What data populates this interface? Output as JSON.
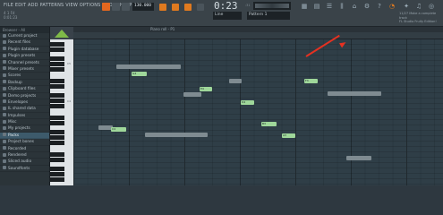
{
  "toolbar": {
    "menu": "FILE EDIT ADD PATTERNS VIEW OPTIONS TOOLS HELP",
    "song_info_line1": "4 1 Fd",
    "song_info_line2": "0:01:23",
    "tempo": "130.000",
    "time": "0:23",
    "time_sub": ":31",
    "pattern": "Pattern 1",
    "line": "Line",
    "news_line1": "11/27 Make a complete track",
    "news_line2": "FL Studio Fruity Edition!"
  },
  "browser": {
    "header": "Browser - All",
    "items": [
      {
        "label": "Current project",
        "active": false
      },
      {
        "label": "Recent files",
        "active": false
      },
      {
        "label": "Plugin database",
        "active": false
      },
      {
        "label": "Plugin presets",
        "active": false
      },
      {
        "label": "Channel presets",
        "active": false
      },
      {
        "label": "Mixer presets",
        "active": false
      },
      {
        "label": "Scores",
        "active": false
      },
      {
        "label": "Backup",
        "active": false
      },
      {
        "label": "Clipboard files",
        "active": false
      },
      {
        "label": "Demo projects",
        "active": false
      },
      {
        "label": "Envelopes",
        "active": false
      },
      {
        "label": "IL shared data",
        "active": false
      },
      {
        "label": "Impulses",
        "active": false
      },
      {
        "label": "Misc",
        "active": false
      },
      {
        "label": "My projects",
        "active": false
      },
      {
        "label": "Packs",
        "active": true
      },
      {
        "label": "Project bones",
        "active": false
      },
      {
        "label": "Recorded",
        "active": false
      },
      {
        "label": "Rendered",
        "active": false
      },
      {
        "label": "Sliced audio",
        "active": false
      },
      {
        "label": "Soundfonts",
        "active": false
      }
    ]
  },
  "piano_roll": {
    "title": "Piano roll - P1",
    "key_labels": [
      "C5",
      "C4"
    ],
    "notes": [
      {
        "label": "",
        "color": "gray"
      },
      {
        "label": "",
        "color": "gray"
      },
      {
        "label": "",
        "color": "gray"
      },
      {
        "label": "G4",
        "color": "green"
      },
      {
        "label": "E4",
        "color": "green"
      },
      {
        "label": "D4",
        "color": "green"
      },
      {
        "label": "C4",
        "color": "green"
      },
      {
        "label": "C4",
        "color": "green"
      },
      {
        "label": "B3",
        "color": "green"
      },
      {
        "label": "A3",
        "color": "green"
      },
      {
        "label": "F3",
        "color": "green"
      },
      {
        "label": "",
        "color": "gray"
      },
      {
        "label": "",
        "color": "gray"
      },
      {
        "label": "",
        "color": "gray"
      },
      {
        "label": "",
        "color": "gray"
      }
    ]
  },
  "colors": {
    "accent": "#e3671f",
    "note_green": "#9fd79a",
    "annotation_arrow": "#e53121"
  }
}
